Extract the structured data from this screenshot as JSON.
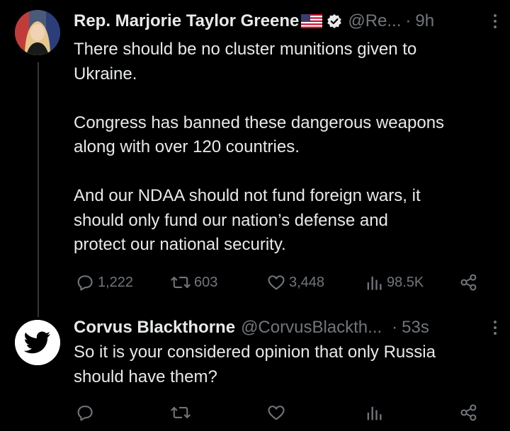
{
  "tweets": [
    {
      "name": "Rep. Marjorie Taylor Greene",
      "flag_icon": "us-flag-emoji",
      "verified_icon": "verified-badge-icon",
      "handle": "@Re...",
      "separator": "·",
      "time": "9h",
      "paragraphs": [
        "There should be no cluster munitions given to\nUkraine.",
        "Congress has banned these dangerous weapons\nalong with over 120 countries.",
        "And our NDAA should not fund foreign wars, it\nshould only fund our nation’s defense and\nprotect our national security."
      ],
      "metrics": {
        "replies": "1,222",
        "retweets": "603",
        "likes": "3,448",
        "views": "98.5K"
      }
    },
    {
      "name": "Corvus Blackthorne",
      "handle": "@CorvusBlackth...",
      "separator": "·",
      "time": "53s",
      "avatar_icon": "twitter-bird-avatar",
      "paragraphs": [
        "So it is your considered opinion that only Russia\nshould have them?"
      ]
    }
  ],
  "colors": {
    "background": "#000000",
    "text": "#e7e9ea",
    "muted": "#71767b",
    "verified": "#1d9bf0",
    "thread_line": "#333639"
  }
}
